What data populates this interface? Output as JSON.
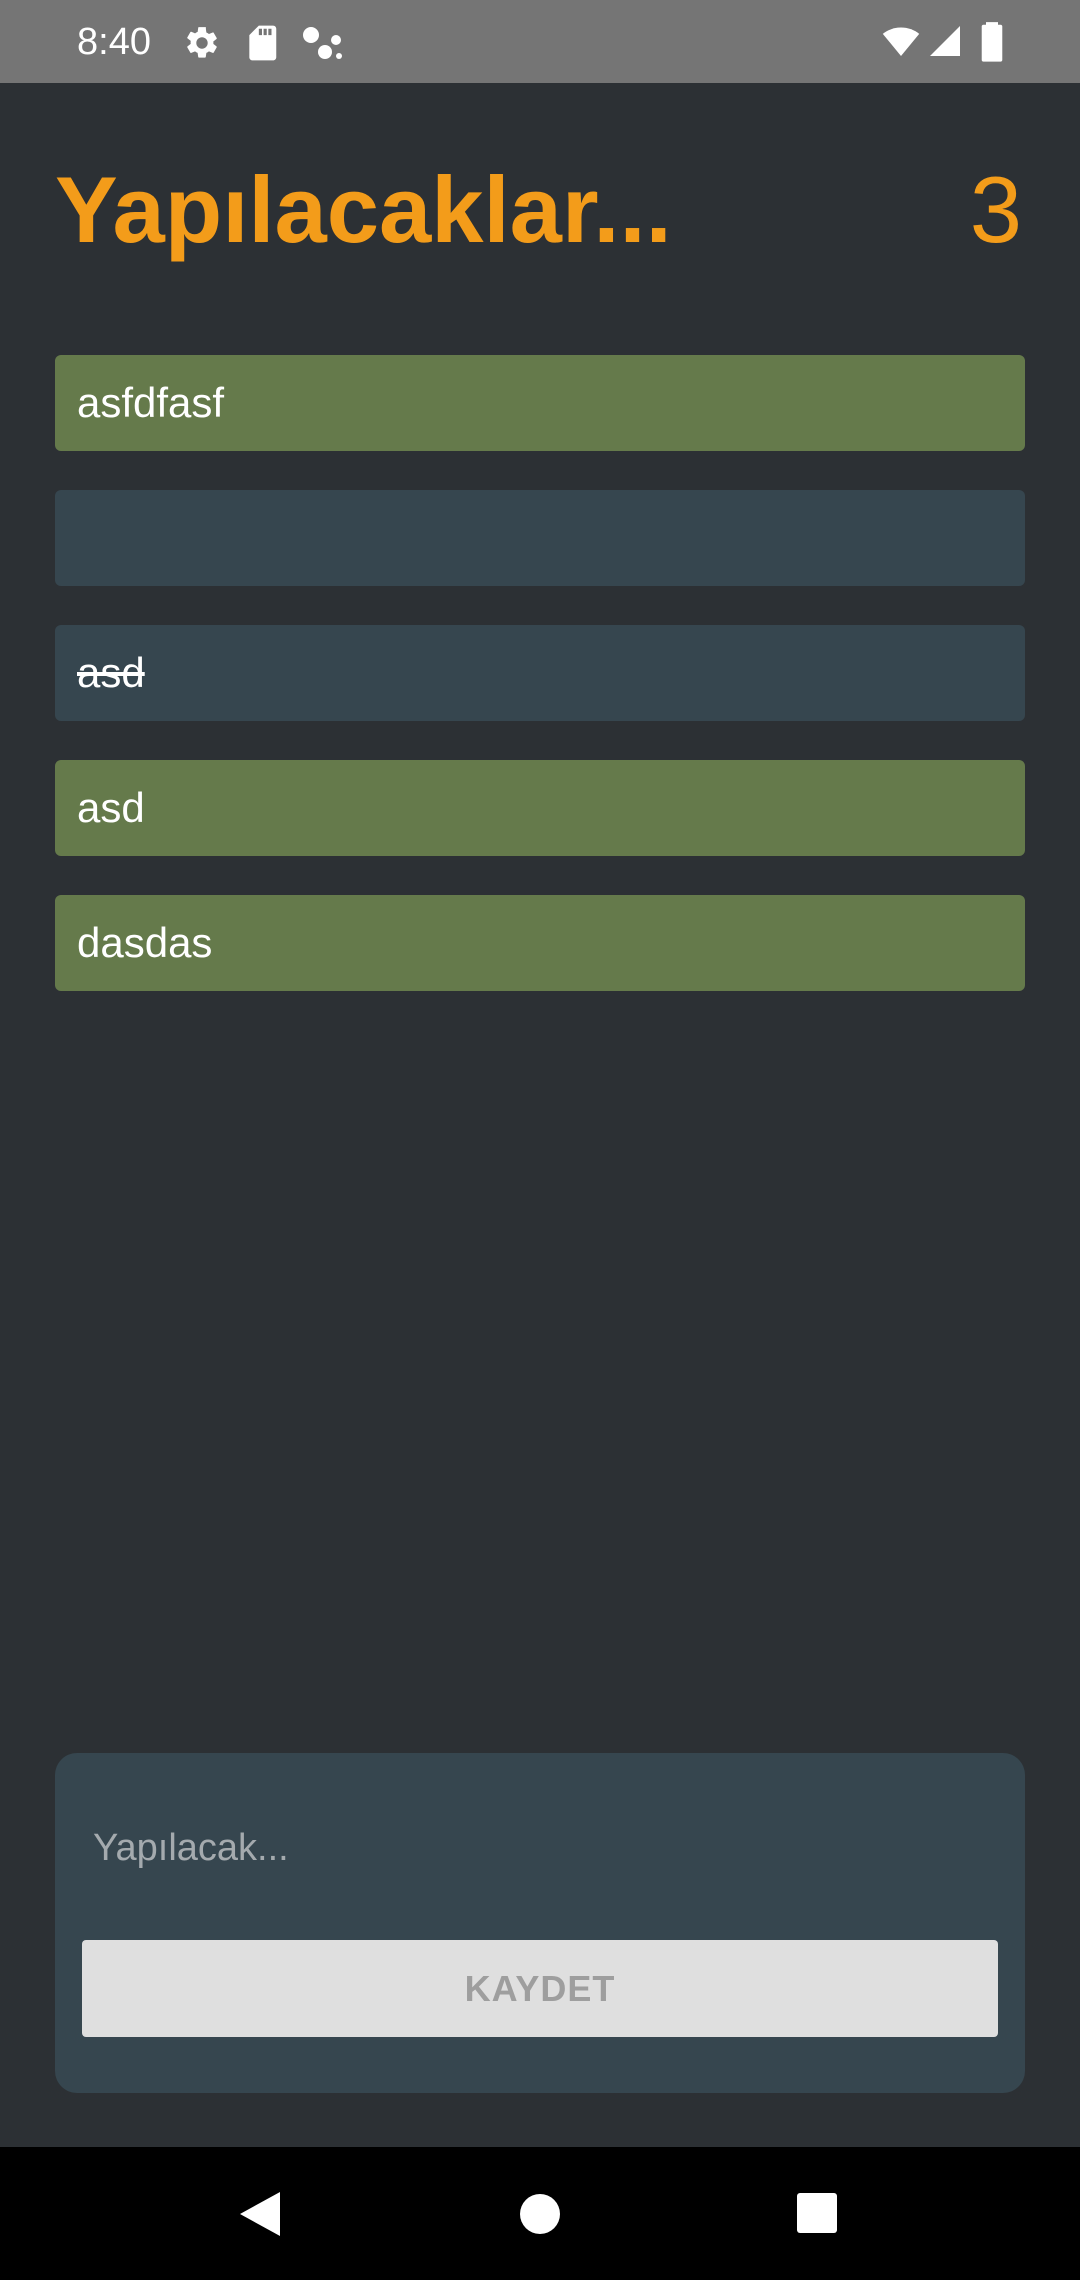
{
  "status_bar": {
    "time": "8:40",
    "left_icons": [
      "gear-icon",
      "sd-card-icon",
      "assistant-dots-icon"
    ],
    "right_icons": [
      "wifi-icon",
      "cell-signal-icon",
      "battery-icon"
    ]
  },
  "header": {
    "title": "Yapılacaklar...",
    "count": "3"
  },
  "tasks": [
    {
      "text": "asfdfasf",
      "completed": false
    },
    {
      "text": "",
      "completed": true
    },
    {
      "text": "asd",
      "completed": true
    },
    {
      "text": "asd",
      "completed": false
    },
    {
      "text": "dasdas",
      "completed": false
    }
  ],
  "input_panel": {
    "value": "",
    "placeholder": "Yapılacak...",
    "save_label": "KAYDET"
  },
  "nav_bar": {
    "icons": [
      "back-icon",
      "home-icon",
      "recents-icon"
    ]
  },
  "colors": {
    "accent": "#f39c1a",
    "background": "#2c3034",
    "task_pending": "#657a4b",
    "task_completed": "#36464f"
  }
}
